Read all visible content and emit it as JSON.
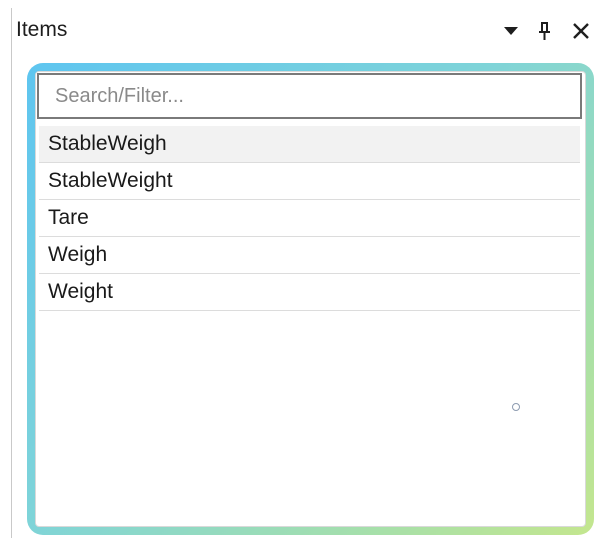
{
  "panel": {
    "title": "Items",
    "buttons": {
      "dropdown_icon": "triangle-down",
      "pin_icon": "pin",
      "close_icon": "close-x"
    }
  },
  "search": {
    "placeholder": "Search/Filter...",
    "value": ""
  },
  "items": [
    {
      "label": "StableWeigh",
      "selected": true
    },
    {
      "label": "StableWeight",
      "selected": false
    },
    {
      "label": "Tare",
      "selected": false
    },
    {
      "label": "Weigh",
      "selected": false
    },
    {
      "label": "Weight",
      "selected": false
    }
  ],
  "colors": {
    "frame_gradient_start": "#5ec5f0",
    "frame_gradient_end": "#c4e68e",
    "selected_row": "#f2f2f2"
  }
}
